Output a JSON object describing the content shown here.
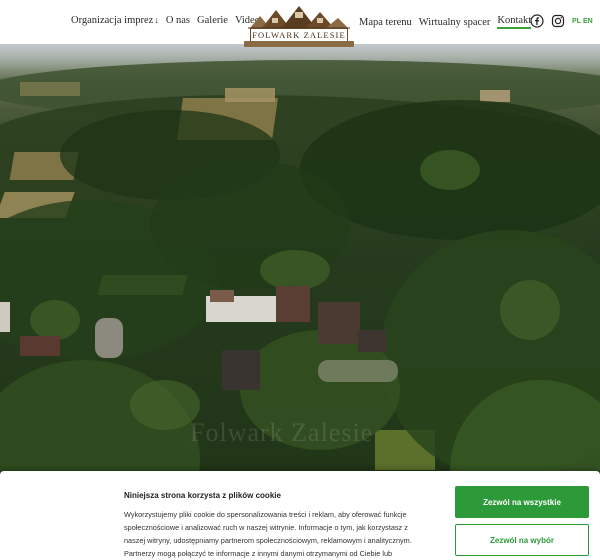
{
  "header": {
    "nav_left": [
      {
        "label": "Organizacja imprez",
        "has_dropdown": true
      },
      {
        "label": "O nas"
      },
      {
        "label": "Galerie"
      },
      {
        "label": "Video"
      }
    ],
    "nav_right": [
      {
        "label": "Mapa terenu"
      },
      {
        "label": "Wirtualny spacer"
      },
      {
        "label": "Kontakt",
        "active": true
      }
    ],
    "logo_text": "FOLWARK ZALESIE",
    "social": [
      "facebook-icon",
      "instagram-icon"
    ],
    "languages": {
      "pl": "PL",
      "en": "EN"
    }
  },
  "hero": {
    "watermark": "Folwark Zalesie"
  },
  "cookie_banner": {
    "title": "Niniejsza strona korzysta z plików cookie",
    "body": "Wykorzystujemy pliki cookie do spersonalizowania treści i reklam, aby oferować funkcje społecznościowe i analizować ruch w naszej witrynie. Informacje o tym, jak korzystasz z naszej witryny, udostępniamy partnerom społecznościowym, reklamowym i analitycznym. Partnerzy mogą połączyć te informacje z innymi danymi otrzymanymi od Ciebie lub",
    "accept_all": "Zezwól na wszystkie",
    "allow_selection": "Zezwól na wybór"
  },
  "colors": {
    "accent_green": "#2c9a38",
    "logo_brown": "#6b4a2a"
  }
}
